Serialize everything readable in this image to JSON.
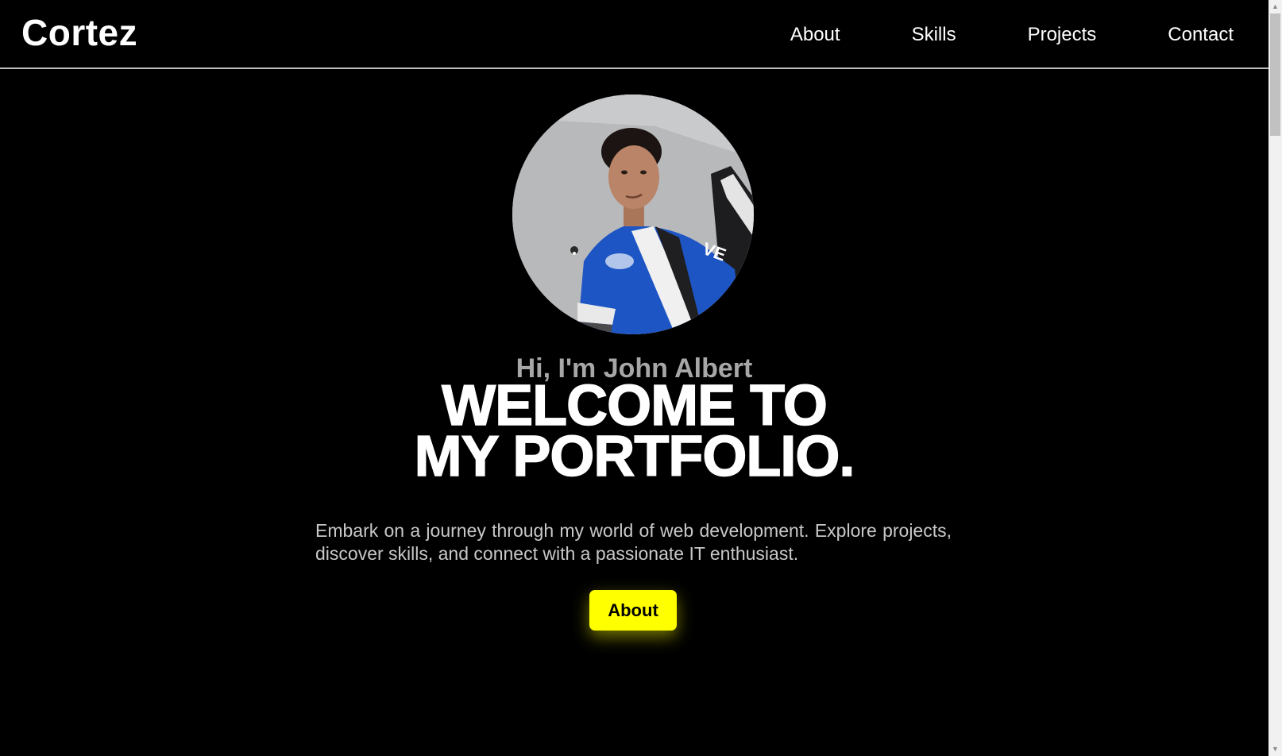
{
  "header": {
    "brand": "Cortez",
    "nav": [
      {
        "label": "About"
      },
      {
        "label": "Skills"
      },
      {
        "label": "Projects"
      },
      {
        "label": "Contact"
      }
    ]
  },
  "hero": {
    "greeting": "Hi, I'm John Albert",
    "headline_line1": "WELCOME TO",
    "headline_line2": "MY PORTFOLIO.",
    "description": "Embark on a journey through my world of web development. Explore projects, discover skills, and connect with a passionate IT enthusiast.",
    "cta_label": "About",
    "avatar_alt": "profile-photo"
  },
  "colors": {
    "background": "#000000",
    "accent": "#ffff00",
    "text": "#ffffff",
    "muted": "#a7a7a7"
  },
  "icons": {
    "scroll_up": "chevron-up-icon",
    "scroll_down": "chevron-down-icon"
  }
}
